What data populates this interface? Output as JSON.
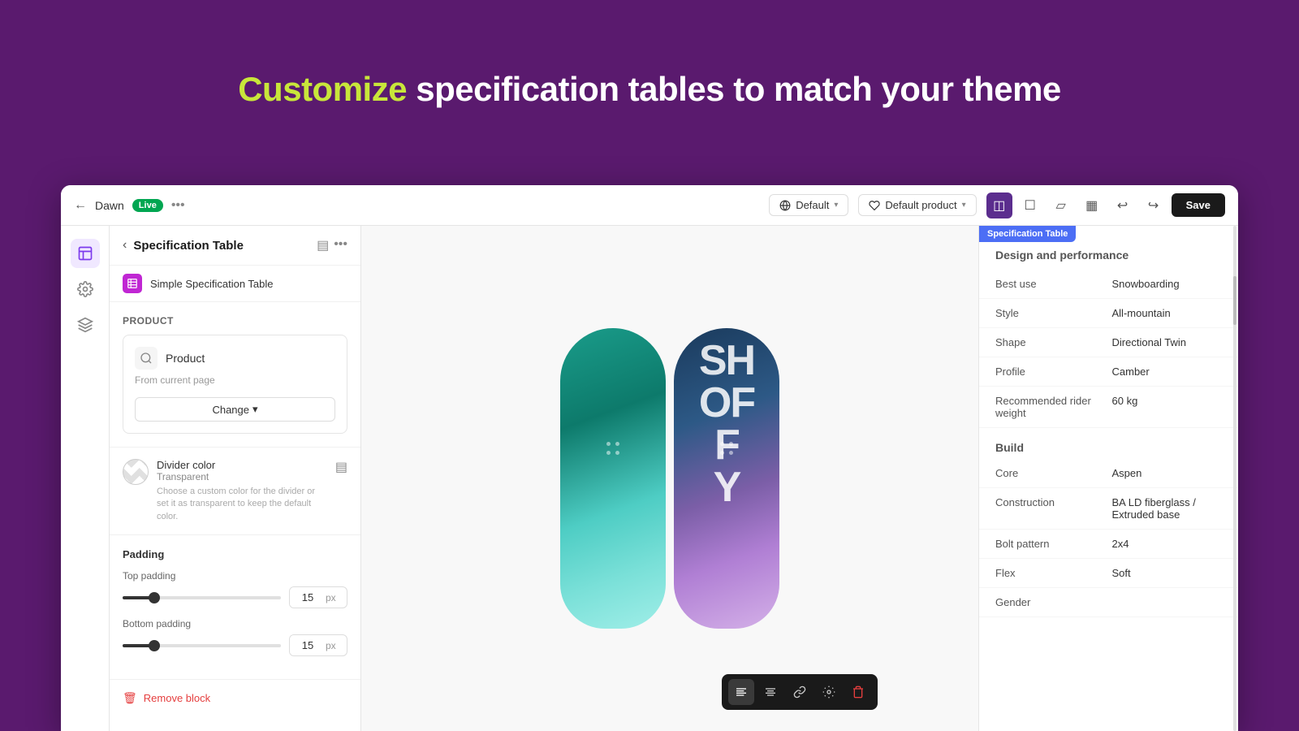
{
  "hero": {
    "title_plain": "specification tables to match your theme",
    "title_highlight": "Customize",
    "full_title": "Customize specification tables to match your theme"
  },
  "topbar": {
    "store_name": "Dawn",
    "live_label": "Live",
    "more_icon": "•••",
    "default_theme": "Default",
    "default_product": "Default product",
    "save_label": "Save"
  },
  "sidebar": {
    "icons": [
      "sections-icon",
      "settings-icon",
      "blocks-icon"
    ]
  },
  "panel": {
    "back_label": "Specification Table",
    "sub_item_label": "Simple Specification Table",
    "product_section_label": "Product",
    "product_name": "Product",
    "product_source": "From current page",
    "change_btn_label": "Change",
    "divider_title": "Divider color",
    "divider_sub": "Transparent",
    "divider_desc": "Choose a custom color for the divider or set it as transparent to keep the default color.",
    "padding_label": "Padding",
    "top_padding_label": "Top padding",
    "top_padding_value": "15",
    "top_padding_unit": "px",
    "bottom_padding_label": "Bottom padding",
    "bottom_padding_value": "15",
    "bottom_padding_unit": "px",
    "remove_label": "Remove block"
  },
  "spec_table": {
    "tag_label": "Specification Table",
    "section_title": "Design and performance",
    "specs": [
      {
        "key": "Best use",
        "value": "Snowboarding"
      },
      {
        "key": "Style",
        "value": "All-mountain"
      },
      {
        "key": "Shape",
        "value": "Directional Twin"
      },
      {
        "key": "Profile",
        "value": "Camber"
      },
      {
        "key": "Recommended rider weight",
        "value": "60 kg"
      }
    ],
    "build_title": "Build",
    "build_specs": [
      {
        "key": "Core",
        "value": "Aspen"
      },
      {
        "key": "Construction",
        "value": "BA LD fiberglass / Extruded base"
      },
      {
        "key": "Bolt pattern",
        "value": "2x4"
      },
      {
        "key": "Flex",
        "value": "Soft"
      },
      {
        "key": "Gender",
        "value": ""
      }
    ]
  },
  "snowboard": {
    "text": "SH OFF Y"
  },
  "toolbar": {
    "buttons": [
      "align-left",
      "align-center",
      "link",
      "edit",
      "delete"
    ]
  }
}
